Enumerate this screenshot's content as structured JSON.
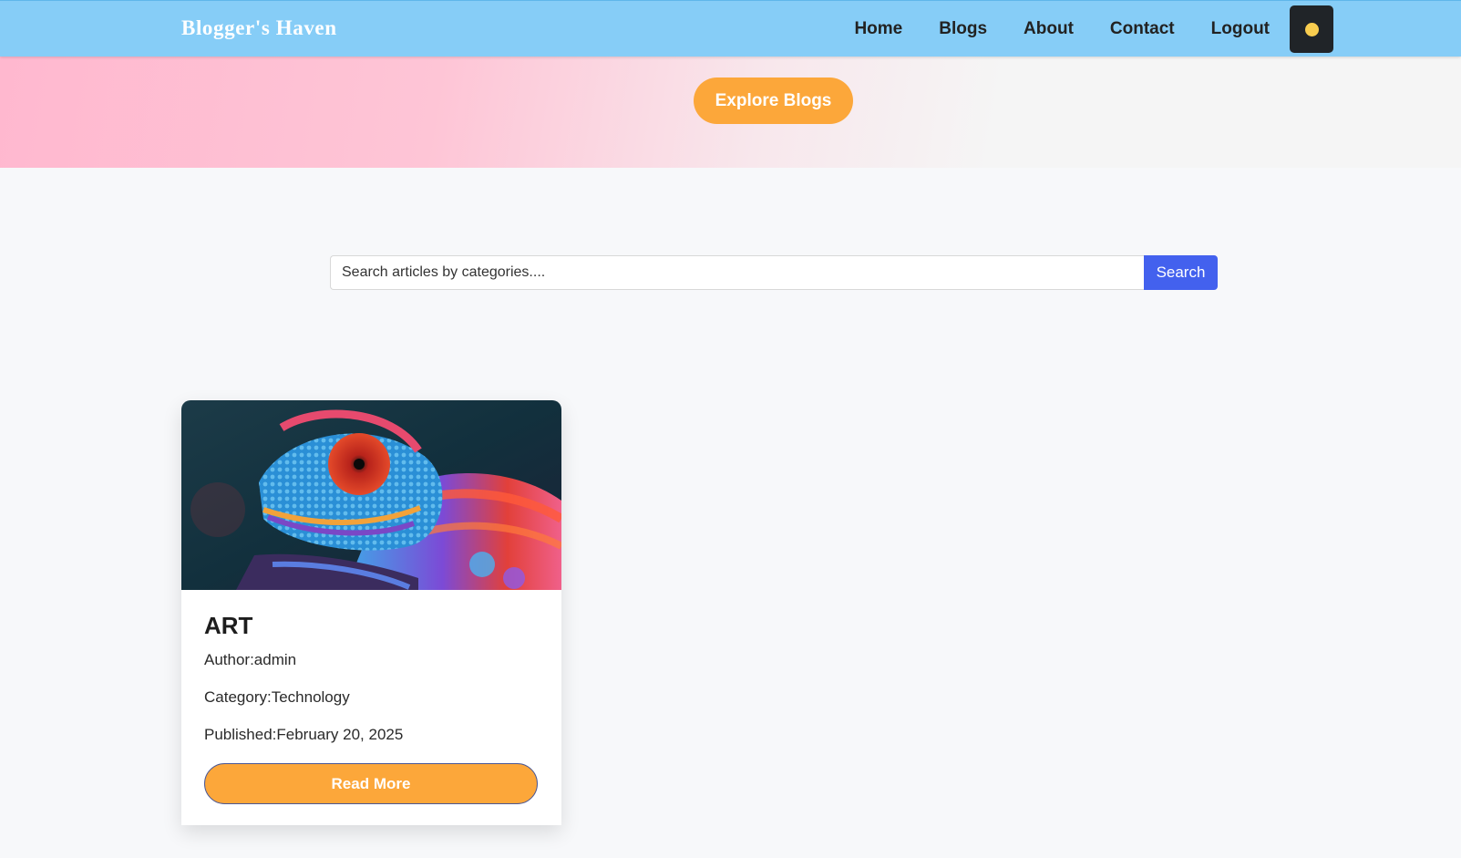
{
  "navbar": {
    "brand": "Blogger's Haven",
    "links": [
      "Home",
      "Blogs",
      "About",
      "Contact",
      "Logout"
    ],
    "theme_toggle_icon": "sun-icon"
  },
  "hero": {
    "explore_label": "Explore Blogs"
  },
  "search": {
    "placeholder": "Search articles by categories....",
    "button_label": "Search"
  },
  "posts": [
    {
      "title": "ART",
      "author": "Author:admin",
      "category": "Category:Technology",
      "published": "Published:February 20, 2025",
      "read_more_label": "Read More",
      "image_subject": "chameleon-image"
    }
  ],
  "colors": {
    "navbar": "#86cdf7",
    "accent_orange": "#fca73a",
    "search_button": "#4361ee",
    "toggle_bg": "#202428",
    "sun": "#f8cd4f"
  }
}
